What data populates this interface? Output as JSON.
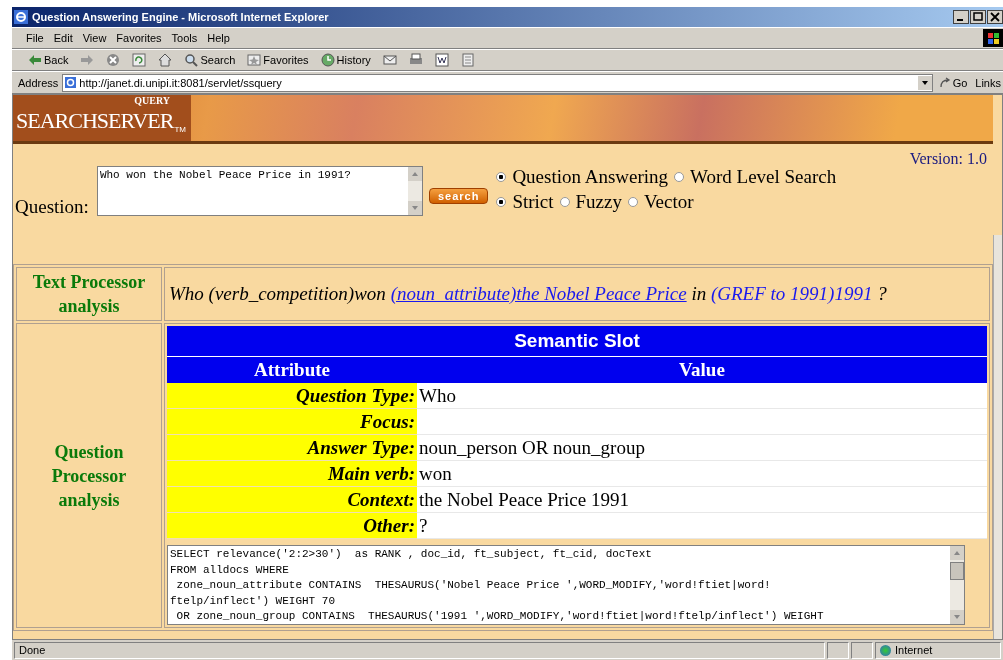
{
  "window": {
    "title": "Question Answering Engine - Microsoft Internet Explorer"
  },
  "menu": [
    "File",
    "Edit",
    "View",
    "Favorites",
    "Tools",
    "Help"
  ],
  "toolbar": [
    {
      "kind": "back",
      "label": "Back"
    },
    {
      "kind": "forward"
    },
    {
      "kind": "stop"
    },
    {
      "kind": "refresh"
    },
    {
      "kind": "home"
    },
    {
      "kind": "search",
      "label": "Search"
    },
    {
      "kind": "favorites",
      "label": "Favorites"
    },
    {
      "kind": "history",
      "label": "History"
    },
    {
      "kind": "mail"
    },
    {
      "kind": "print"
    },
    {
      "kind": "word"
    },
    {
      "kind": "discuss"
    }
  ],
  "address": {
    "label": "Address",
    "value": "http://janet.di.unipi.it:8081/servlet/ssquery",
    "go": "Go",
    "links": "Links"
  },
  "banner": {
    "logo_small": "QUERY",
    "logo": "SEARCHSERVER",
    "tm": "TM"
  },
  "version": "Version: 1.0",
  "question": {
    "label": "Question:",
    "value": "Who won the Nobel Peace Price in 1991?",
    "button": "search"
  },
  "modes": [
    {
      "label": "Question Answering",
      "selected": true
    },
    {
      "label": "Word Level Search",
      "selected": false
    }
  ],
  "matching": [
    {
      "label": "Strict",
      "selected": true
    },
    {
      "label": "Fuzzy",
      "selected": false
    },
    {
      "label": "Vector",
      "selected": false
    }
  ],
  "text_processor": {
    "heading": "Text Processor analysis",
    "segments": [
      {
        "kind": "text",
        "text": "Who (verb_competition)won "
      },
      {
        "kind": "link",
        "text": "(noun_attribute)the Nobel Peace Price"
      },
      {
        "kind": "text",
        "text": " in "
      },
      {
        "kind": "tag",
        "text": "(GREF to 1991)1991"
      },
      {
        "kind": "text",
        "text": " ?"
      }
    ]
  },
  "question_processor": {
    "heading": "Question Processor analysis",
    "table_title": "Semantic Slot",
    "columns": [
      "Attribute",
      "Value"
    ],
    "rows": [
      {
        "attribute": "Question Type:",
        "value": "Who"
      },
      {
        "attribute": "Focus:",
        "value": ""
      },
      {
        "attribute": "Answer Type:",
        "value": "noun_person OR noun_group"
      },
      {
        "attribute": "Main verb:",
        "value": "won"
      },
      {
        "attribute": "Context:",
        "value": "the Nobel Peace Price 1991"
      },
      {
        "attribute": "Other:",
        "value": "?"
      }
    ],
    "query_lines": [
      "SELECT relevance('2:2>30')  as RANK , doc_id, ft_subject, ft_cid, docText",
      "FROM alldocs WHERE",
      " zone_noun_attribute CONTAINS  THESAURUS('Nobel Peace Price ',WORD_MODIFY,'word!ftiet|word!",
      "ftelp/inflect') WEIGHT 70",
      " OR zone_noun_group CONTAINS  THESAURUS('1991 ',WORD_MODIFY,'word!ftiet|word!ftelp/inflect') WEIGHT"
    ]
  },
  "status_bar": {
    "text": "Done",
    "zone": "Internet"
  }
}
